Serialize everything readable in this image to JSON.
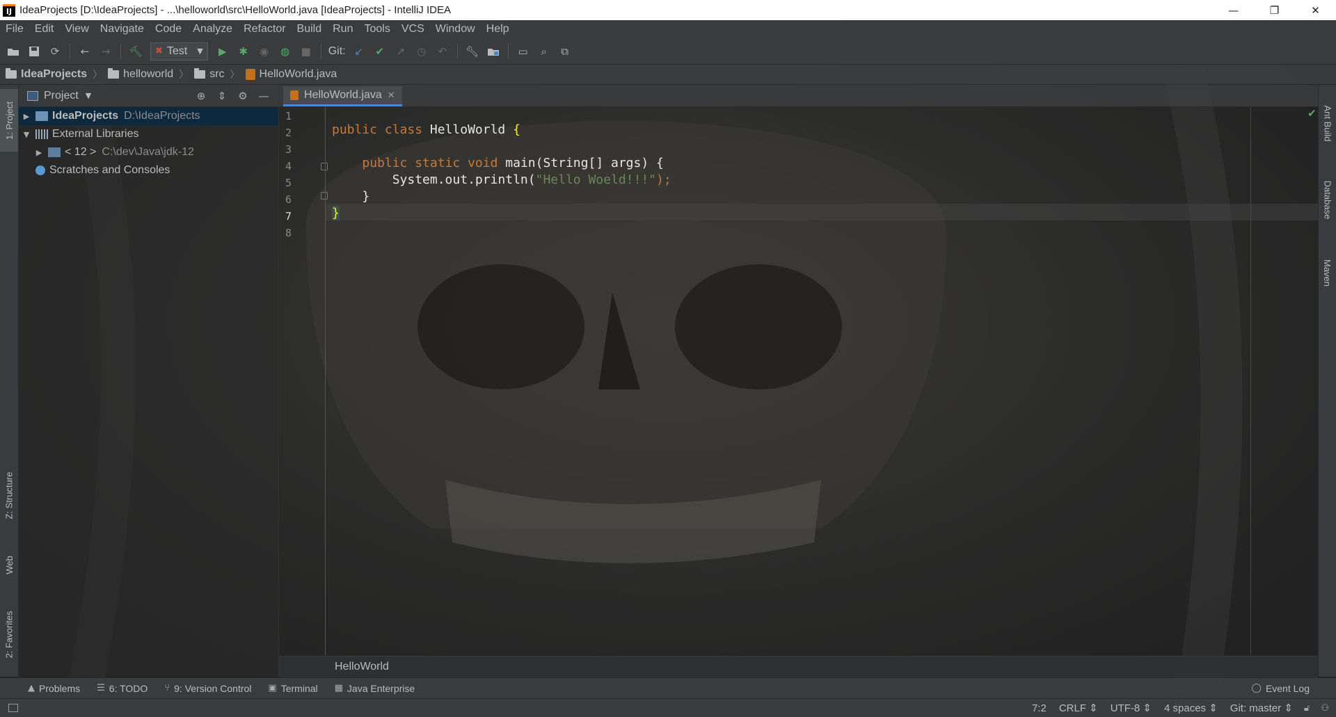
{
  "window": {
    "title": "IdeaProjects [D:\\IdeaProjects] - ...\\helloworld\\src\\HelloWorld.java [IdeaProjects] - IntelliJ IDEA",
    "minimize": "—",
    "restore": "❐",
    "close": "✕"
  },
  "menu": {
    "items": [
      "File",
      "Edit",
      "View",
      "Navigate",
      "Code",
      "Analyze",
      "Refactor",
      "Build",
      "Run",
      "Tools",
      "VCS",
      "Window",
      "Help"
    ]
  },
  "toolbar": {
    "run_config": "Test",
    "git_label": "Git:"
  },
  "breadcrumb": {
    "items": [
      "IdeaProjects",
      "helloworld",
      "src",
      "HelloWorld.java"
    ]
  },
  "left_strip": {
    "project": "1: Project",
    "structure": "Z: Structure",
    "web": "Web",
    "favorites": "2: Favorites"
  },
  "right_strip": {
    "ant": "Ant Build",
    "database": "Database",
    "maven": "Maven"
  },
  "project_panel": {
    "title": "Project",
    "tree": [
      {
        "label": "IdeaProjects",
        "path": "D:\\IdeaProjects"
      },
      {
        "label": "External Libraries"
      },
      {
        "label": "< 12 >",
        "path": "C:\\dev\\Java\\jdk-12"
      },
      {
        "label": "Scratches and Consoles"
      }
    ]
  },
  "editor": {
    "tab": "HelloWorld.java",
    "line_numbers": [
      "1",
      "2",
      "3",
      "4",
      "5",
      "6",
      "7",
      "8"
    ],
    "code": {
      "l2_kw": "public class",
      "l2_name": " HelloWorld ",
      "l2_brace": "{",
      "l4_indent": "    ",
      "l4_kw": "public static void",
      "l4_rest": " main(String[] args) {",
      "l5_text": "        System.out.println(",
      "l5_str": "\"Hello Woeld!!!\"",
      "l5_end": ");",
      "l6": "    }",
      "l7": "}"
    },
    "footer_breadcrumb": "HelloWorld"
  },
  "bottom_tabs": [
    "Problems",
    "6: TODO",
    "9: Version Control",
    "Terminal",
    "Java Enterprise"
  ],
  "event_log": "Event Log",
  "status": {
    "position": "7:2",
    "line_sep": "CRLF",
    "encoding": "UTF-8",
    "indent": "4 spaces",
    "git": "Git: master"
  }
}
